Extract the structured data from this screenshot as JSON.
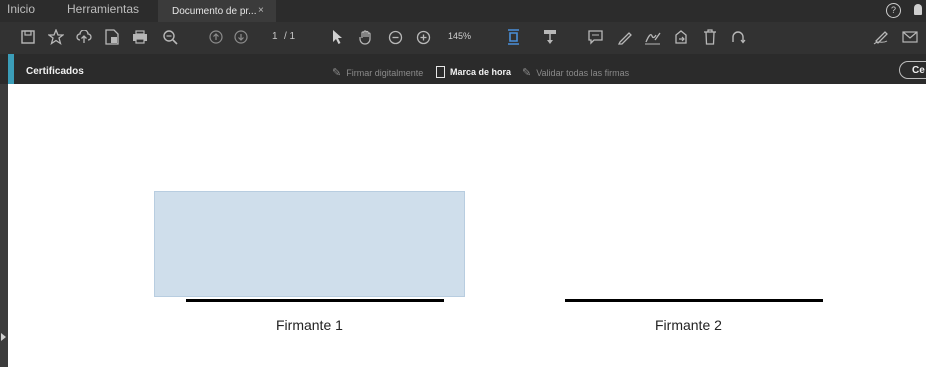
{
  "tabs": {
    "home": "Inicio",
    "tools": "Herramientas",
    "document": "Documento de pr...",
    "close": "×"
  },
  "header_icons": [
    "help-icon",
    "bell-icon"
  ],
  "toolbar": {
    "icons": [
      "save-icon",
      "bookmark-star-icon",
      "upload-cloud-icon",
      "create-pdf-icon",
      "print-icon",
      "search-icon",
      "previous-page-icon",
      "next-page-icon"
    ],
    "page_current": "1",
    "page_total": "/ 1",
    "zoom": "145%",
    "right_icons": [
      "select-pointer-icon",
      "hand-icon",
      "zoom-out-icon",
      "zoom-in-icon",
      "fit-page-icon",
      "stamp-icon",
      "comment-icon",
      "pen-icon",
      "sign-icon",
      "share-icon",
      "delete-icon",
      "rotate-icon",
      "draw-icon",
      "mail-icon"
    ]
  },
  "certbar": {
    "title": "Certificados",
    "sign_digitally": "Firmar digitalmente",
    "timestamp": "Marca de hora",
    "validate_all": "Validar todas las firmas",
    "close_label": "Ce"
  },
  "document": {
    "signer1": "Firmante 1",
    "signer2": "Firmante 2"
  },
  "colors": {
    "accent": "#3b9db8",
    "signature_field": "#cfdeeb"
  }
}
